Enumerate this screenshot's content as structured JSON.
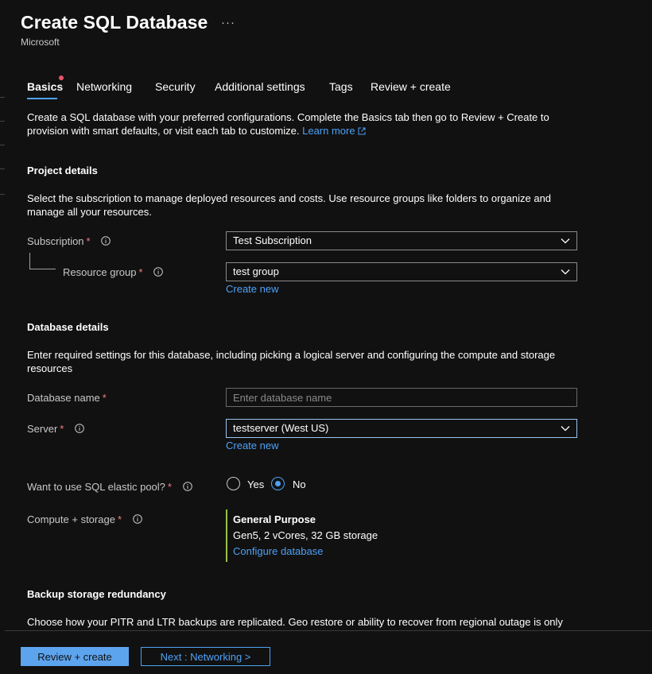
{
  "header": {
    "title": "Create SQL Database",
    "more_label": "···",
    "publisher": "Microsoft"
  },
  "tabs": [
    {
      "label": "Basics",
      "active": true,
      "has_error_dot": true
    },
    {
      "label": "Networking"
    },
    {
      "label": "Security"
    },
    {
      "label": "Additional settings"
    },
    {
      "label": "Tags"
    },
    {
      "label": "Review + create"
    }
  ],
  "intro": {
    "text": "Create a SQL database with your preferred configurations. Complete the Basics tab then go to Review + Create to provision with smart defaults, or visit each tab to customize.",
    "learn_more": "Learn more"
  },
  "project_details": {
    "title": "Project details",
    "description": "Select the subscription to manage deployed resources and costs. Use resource groups like folders to organize and manage all your resources.",
    "subscription": {
      "label": "Subscription",
      "required": "*",
      "value": "Test Subscription"
    },
    "resource_group": {
      "label": "Resource group",
      "required": "*",
      "value": "test group",
      "create_new": "Create new"
    }
  },
  "database_details": {
    "title": "Database details",
    "description": "Enter required settings for this database, including picking a logical server and configuring the compute and storage resources",
    "database_name": {
      "label": "Database name",
      "required": "*",
      "value": "",
      "placeholder": "Enter database name"
    },
    "server": {
      "label": "Server",
      "required": "*",
      "value": "testserver (West US)",
      "create_new": "Create new"
    },
    "elastic_pool": {
      "label": "Want to use SQL elastic pool?",
      "required": "*",
      "options": [
        "Yes",
        "No"
      ],
      "selected": "No"
    },
    "compute_storage": {
      "label": "Compute + storage",
      "required": "*",
      "tier": "General Purpose",
      "details": "Gen5, 2 vCores, 32 GB storage",
      "configure_link": "Configure database"
    }
  },
  "backup": {
    "title": "Backup storage redundancy",
    "description": "Choose how your PITR and LTR backups are replicated. Geo restore or ability to recover from regional outage is only"
  },
  "footer": {
    "review_create": "Review + create",
    "next": "Next : Networking >"
  },
  "colors": {
    "background": "#111111",
    "accent": "#4ea1f5",
    "required": "#f17d86",
    "compute_bar": "#98c24a",
    "primary_button": "#5da4ee"
  }
}
